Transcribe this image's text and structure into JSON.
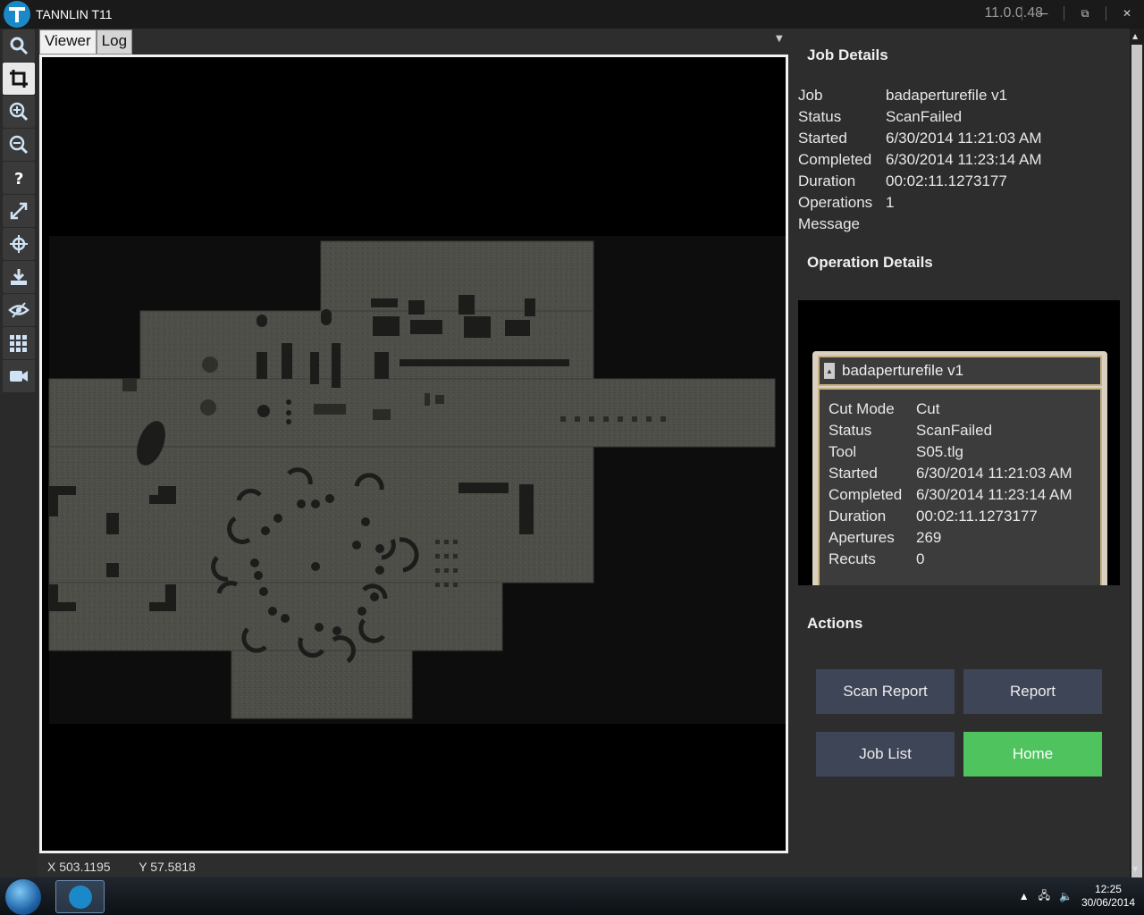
{
  "app": {
    "title": "TANNLIN T11",
    "version": "11.0.0.48"
  },
  "window_controls": {
    "minimize": "—",
    "restore": "⧉",
    "close": "✕"
  },
  "toolbar": {
    "tools": [
      "search-icon",
      "crop-icon",
      "zoom-in-icon",
      "zoom-out-icon",
      "help-icon",
      "expand-icon",
      "target-icon",
      "download-icon",
      "visibility-icon",
      "grid-icon",
      "camera-icon"
    ]
  },
  "tabs": [
    {
      "label": "Viewer"
    },
    {
      "label": "Log"
    }
  ],
  "coordinates": {
    "x": "X 503.1195",
    "y": "Y 57.5818"
  },
  "job_details": {
    "title": "Job Details",
    "rows": [
      {
        "key": "Job",
        "value": "badaperturefile v1"
      },
      {
        "key": "Status",
        "value": "ScanFailed"
      },
      {
        "key": "Started",
        "value": "6/30/2014 11:21:03 AM"
      },
      {
        "key": "Completed",
        "value": "6/30/2014 11:23:14 AM"
      },
      {
        "key": "Duration",
        "value": "00:02:11.1273177"
      },
      {
        "key": "Operations",
        "value": "1"
      },
      {
        "key": "Message",
        "value": ""
      }
    ]
  },
  "operation_details": {
    "title": "Operation Details",
    "card_title": "badaperturefile v1",
    "rows": [
      {
        "key": "Cut Mode",
        "value": "Cut"
      },
      {
        "key": "Status",
        "value": "ScanFailed"
      },
      {
        "key": "Tool",
        "value": "S05.tlg"
      },
      {
        "key": "Started",
        "value": "6/30/2014 11:21:03 AM"
      },
      {
        "key": "Completed",
        "value": "6/30/2014 11:23:14 AM"
      },
      {
        "key": "Duration",
        "value": "00:02:11.1273177"
      },
      {
        "key": "Apertures",
        "value": "269"
      },
      {
        "key": "Recuts",
        "value": "0"
      }
    ]
  },
  "actions": {
    "title": "Actions",
    "scan_report": "Scan Report",
    "report": "Report",
    "job_list": "Job List",
    "home": "Home"
  },
  "taskbar": {
    "time": "12:25",
    "date": "30/06/2014"
  },
  "colors": {
    "home_button": "#4ec35e",
    "action_button": "#3e4557",
    "brand_blue": "#1b88c7"
  }
}
